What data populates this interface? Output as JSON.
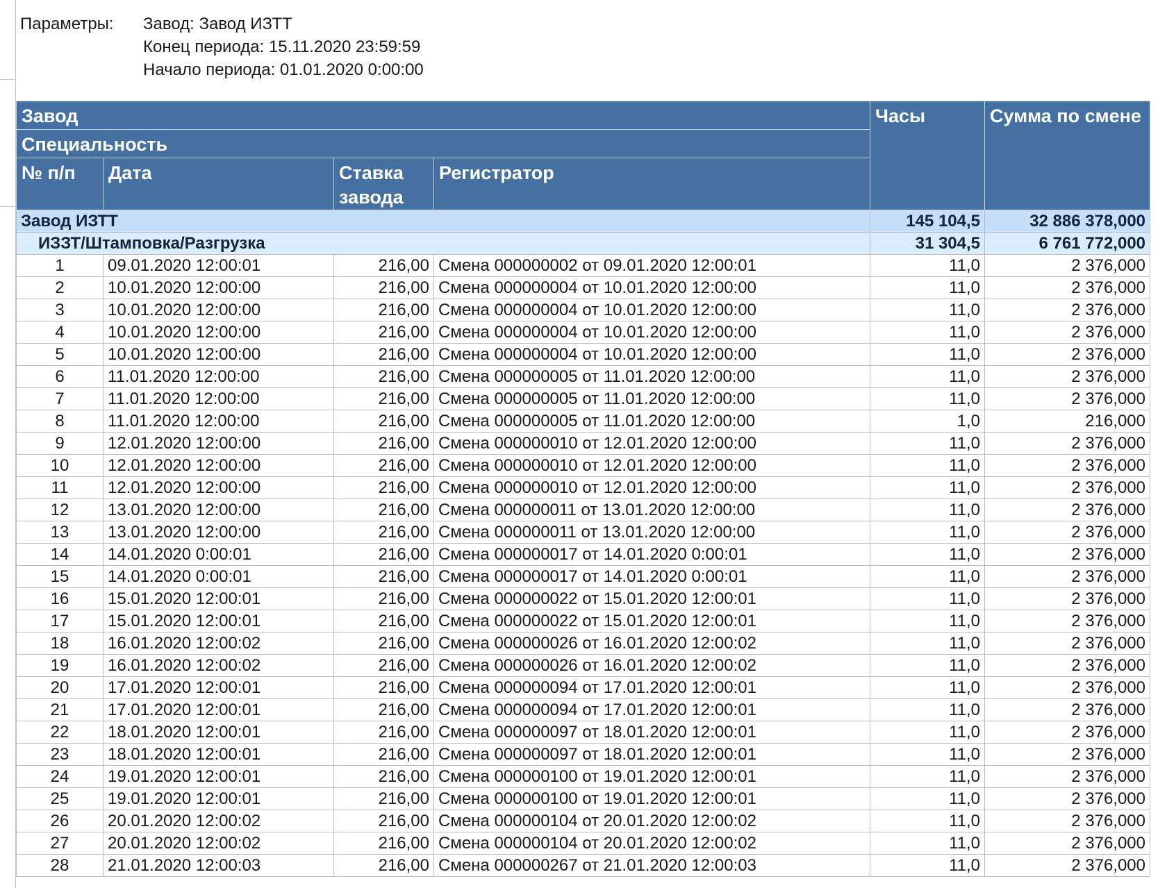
{
  "params": {
    "label": "Параметры:",
    "lines": [
      "Завод: Завод ИЗТТ",
      "Конец периода: 15.11.2020 23:59:59",
      "Начало периода: 01.01.2020 0:00:00"
    ]
  },
  "header": {
    "factory": "Завод",
    "specialty": "Специальность",
    "no": "№ п/п",
    "date": "Дата",
    "rate": "Ставка завода",
    "registrar": "Регистратор",
    "hours": "Часы",
    "sum": "Сумма по смене"
  },
  "group": {
    "name": "Завод ИЗТТ",
    "hours": "145 104,5",
    "sum": "32 886 378,000"
  },
  "subgroup": {
    "name": "ИЗЗТ/Штамповка/Разгрузка",
    "hours": "31 304,5",
    "sum": "6 761 772,000"
  },
  "rows": [
    {
      "no": "1",
      "date": "09.01.2020 12:00:01",
      "rate": "216,00",
      "registrar": "Смена 000000002 от 09.01.2020 12:00:01",
      "hours": "11,0",
      "sum": "2 376,000"
    },
    {
      "no": "2",
      "date": "10.01.2020 12:00:00",
      "rate": "216,00",
      "registrar": "Смена 000000004 от 10.01.2020 12:00:00",
      "hours": "11,0",
      "sum": "2 376,000"
    },
    {
      "no": "3",
      "date": "10.01.2020 12:00:00",
      "rate": "216,00",
      "registrar": "Смена 000000004 от 10.01.2020 12:00:00",
      "hours": "11,0",
      "sum": "2 376,000"
    },
    {
      "no": "4",
      "date": "10.01.2020 12:00:00",
      "rate": "216,00",
      "registrar": "Смена 000000004 от 10.01.2020 12:00:00",
      "hours": "11,0",
      "sum": "2 376,000"
    },
    {
      "no": "5",
      "date": "10.01.2020 12:00:00",
      "rate": "216,00",
      "registrar": "Смена 000000004 от 10.01.2020 12:00:00",
      "hours": "11,0",
      "sum": "2 376,000"
    },
    {
      "no": "6",
      "date": "11.01.2020 12:00:00",
      "rate": "216,00",
      "registrar": "Смена 000000005 от 11.01.2020 12:00:00",
      "hours": "11,0",
      "sum": "2 376,000"
    },
    {
      "no": "7",
      "date": "11.01.2020 12:00:00",
      "rate": "216,00",
      "registrar": "Смена 000000005 от 11.01.2020 12:00:00",
      "hours": "11,0",
      "sum": "2 376,000"
    },
    {
      "no": "8",
      "date": "11.01.2020 12:00:00",
      "rate": "216,00",
      "registrar": "Смена 000000005 от 11.01.2020 12:00:00",
      "hours": "1,0",
      "sum": "216,000"
    },
    {
      "no": "9",
      "date": "12.01.2020 12:00:00",
      "rate": "216,00",
      "registrar": "Смена 000000010 от 12.01.2020 12:00:00",
      "hours": "11,0",
      "sum": "2 376,000"
    },
    {
      "no": "10",
      "date": "12.01.2020 12:00:00",
      "rate": "216,00",
      "registrar": "Смена 000000010 от 12.01.2020 12:00:00",
      "hours": "11,0",
      "sum": "2 376,000"
    },
    {
      "no": "11",
      "date": "12.01.2020 12:00:00",
      "rate": "216,00",
      "registrar": "Смена 000000010 от 12.01.2020 12:00:00",
      "hours": "11,0",
      "sum": "2 376,000"
    },
    {
      "no": "12",
      "date": "13.01.2020 12:00:00",
      "rate": "216,00",
      "registrar": "Смена 000000011 от 13.01.2020 12:00:00",
      "hours": "11,0",
      "sum": "2 376,000"
    },
    {
      "no": "13",
      "date": "13.01.2020 12:00:00",
      "rate": "216,00",
      "registrar": "Смена 000000011 от 13.01.2020 12:00:00",
      "hours": "11,0",
      "sum": "2 376,000"
    },
    {
      "no": "14",
      "date": "14.01.2020 0:00:01",
      "rate": "216,00",
      "registrar": "Смена 000000017 от 14.01.2020 0:00:01",
      "hours": "11,0",
      "sum": "2 376,000"
    },
    {
      "no": "15",
      "date": "14.01.2020 0:00:01",
      "rate": "216,00",
      "registrar": "Смена 000000017 от 14.01.2020 0:00:01",
      "hours": "11,0",
      "sum": "2 376,000"
    },
    {
      "no": "16",
      "date": "15.01.2020 12:00:01",
      "rate": "216,00",
      "registrar": "Смена 000000022 от 15.01.2020 12:00:01",
      "hours": "11,0",
      "sum": "2 376,000"
    },
    {
      "no": "17",
      "date": "15.01.2020 12:00:01",
      "rate": "216,00",
      "registrar": "Смена 000000022 от 15.01.2020 12:00:01",
      "hours": "11,0",
      "sum": "2 376,000"
    },
    {
      "no": "18",
      "date": "16.01.2020 12:00:02",
      "rate": "216,00",
      "registrar": "Смена 000000026 от 16.01.2020 12:00:02",
      "hours": "11,0",
      "sum": "2 376,000"
    },
    {
      "no": "19",
      "date": "16.01.2020 12:00:02",
      "rate": "216,00",
      "registrar": "Смена 000000026 от 16.01.2020 12:00:02",
      "hours": "11,0",
      "sum": "2 376,000"
    },
    {
      "no": "20",
      "date": "17.01.2020 12:00:01",
      "rate": "216,00",
      "registrar": "Смена 000000094 от 17.01.2020 12:00:01",
      "hours": "11,0",
      "sum": "2 376,000"
    },
    {
      "no": "21",
      "date": "17.01.2020 12:00:01",
      "rate": "216,00",
      "registrar": "Смена 000000094 от 17.01.2020 12:00:01",
      "hours": "11,0",
      "sum": "2 376,000"
    },
    {
      "no": "22",
      "date": "18.01.2020 12:00:01",
      "rate": "216,00",
      "registrar": "Смена 000000097 от 18.01.2020 12:00:01",
      "hours": "11,0",
      "sum": "2 376,000"
    },
    {
      "no": "23",
      "date": "18.01.2020 12:00:01",
      "rate": "216,00",
      "registrar": "Смена 000000097 от 18.01.2020 12:00:01",
      "hours": "11,0",
      "sum": "2 376,000"
    },
    {
      "no": "24",
      "date": "19.01.2020 12:00:01",
      "rate": "216,00",
      "registrar": "Смена 000000100 от 19.01.2020 12:00:01",
      "hours": "11,0",
      "sum": "2 376,000"
    },
    {
      "no": "25",
      "date": "19.01.2020 12:00:01",
      "rate": "216,00",
      "registrar": "Смена 000000100 от 19.01.2020 12:00:01",
      "hours": "11,0",
      "sum": "2 376,000"
    },
    {
      "no": "26",
      "date": "20.01.2020 12:00:02",
      "rate": "216,00",
      "registrar": "Смена 000000104 от 20.01.2020 12:00:02",
      "hours": "11,0",
      "sum": "2 376,000"
    },
    {
      "no": "27",
      "date": "20.01.2020 12:00:02",
      "rate": "216,00",
      "registrar": "Смена 000000104 от 20.01.2020 12:00:02",
      "hours": "11,0",
      "sum": "2 376,000"
    },
    {
      "no": "28",
      "date": "21.01.2020 12:00:03",
      "rate": "216,00",
      "registrar": "Смена 000000267 от 21.01.2020 12:00:03",
      "hours": "11,0",
      "sum": "2 376,000"
    }
  ]
}
